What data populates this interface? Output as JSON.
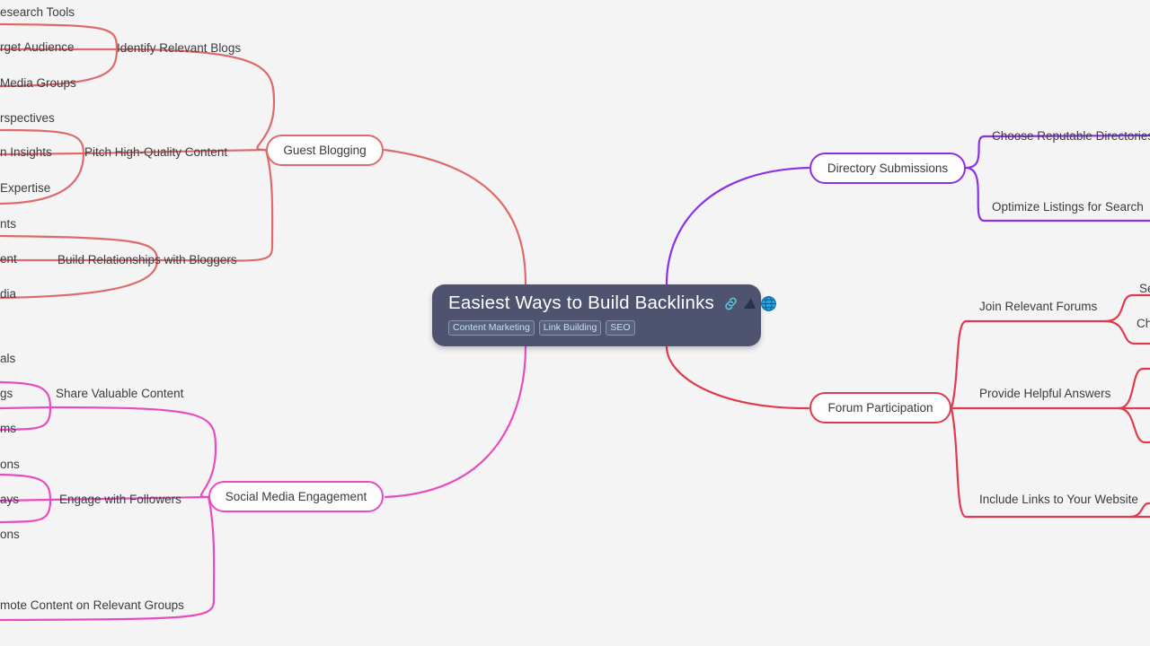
{
  "background_color": "#f4f4f4",
  "root": {
    "title": "Easiest Ways to Build Backlinks",
    "icons": [
      "link-icon",
      "flag-icon",
      "globe-icon"
    ],
    "tags": [
      "Content Marketing",
      "Link Building",
      "SEO"
    ],
    "background_color": "#4e5370",
    "text_color": "#ffffff",
    "tag_text_color": "#bfe3ef"
  },
  "branches": [
    {
      "id": "guest-blogging",
      "label": "Guest Blogging",
      "color": "#dd6b6b",
      "side": "left",
      "children": [
        {
          "label": "Identify Relevant Blogs",
          "leaves": [
            "esearch Tools",
            "rget Audience",
            "Media Groups"
          ]
        },
        {
          "label": "Pitch High-Quality Content",
          "leaves": [
            "rspectives",
            "n Insights",
            "Expertise"
          ]
        },
        {
          "label": "Build Relationships with Bloggers",
          "leaves": [
            "nts",
            "ent",
            "dia"
          ]
        }
      ]
    },
    {
      "id": "directory-submissions",
      "label": "Directory Submissions",
      "color": "#8b2fe8",
      "side": "right",
      "children": [
        {
          "label": "Choose Reputable Directories",
          "leaves": []
        },
        {
          "label": "Optimize Listings for Search",
          "leaves": []
        }
      ]
    },
    {
      "id": "forum-participation",
      "label": "Forum Participation",
      "color": "#e03a4e",
      "side": "right",
      "children": [
        {
          "label": "Join Relevant Forums",
          "leaves": [
            "Se",
            "Ch"
          ]
        },
        {
          "label": "Provide Helpful Answers",
          "leaves": []
        },
        {
          "label": "Include Links to Your Website",
          "leaves": []
        }
      ]
    },
    {
      "id": "social-media-engagement",
      "label": "Social Media Engagement",
      "color": "#e84bc0",
      "side": "left",
      "children": [
        {
          "label": "Share Valuable Content",
          "leaves": [
            "als",
            "gs",
            "ms"
          ]
        },
        {
          "label": "Engage with Followers",
          "leaves": [
            "ons",
            "ays",
            "ons"
          ]
        },
        {
          "label": "mote Content on Relevant Groups",
          "leaves": []
        }
      ]
    }
  ],
  "labels": {
    "identify_relevant_blogs": "Identify Relevant Blogs",
    "pitch_high_quality_content": "Pitch High-Quality Content",
    "build_relationships_with_bloggers": "Build Relationships with Bloggers",
    "choose_reputable_directories": "Choose Reputable Directories",
    "optimize_listings_for_search": "Optimize Listings for Search",
    "join_relevant_forums": "Join Relevant Forums",
    "provide_helpful_answers": "Provide Helpful Answers",
    "include_links_to_your_website": "Include Links to Your Website",
    "share_valuable_content": "Share Valuable Content",
    "engage_with_followers": "Engage with Followers",
    "promote_content_on_relevant_groups": "mote Content on Relevant Groups",
    "guest_blogging": "Guest Blogging",
    "directory_submissions": "Directory Submissions",
    "forum_participation": "Forum Participation",
    "social_media_engagement": "Social Media Engagement",
    "leaf_research_tools": "esearch Tools",
    "leaf_target_audience": "rget Audience",
    "leaf_media_groups": "Media Groups",
    "leaf_perspectives": "rspectives",
    "leaf_insights": "n Insights",
    "leaf_expertise": "Expertise",
    "leaf_nts": "nts",
    "leaf_ent": "ent",
    "leaf_dia": "dia",
    "leaf_als": "als",
    "leaf_gs": "gs",
    "leaf_ms": "ms",
    "leaf_ons1": "ons",
    "leaf_ays": "ays",
    "leaf_ons2": "ons",
    "leaf_se": "Se",
    "leaf_ch": "Ch"
  }
}
